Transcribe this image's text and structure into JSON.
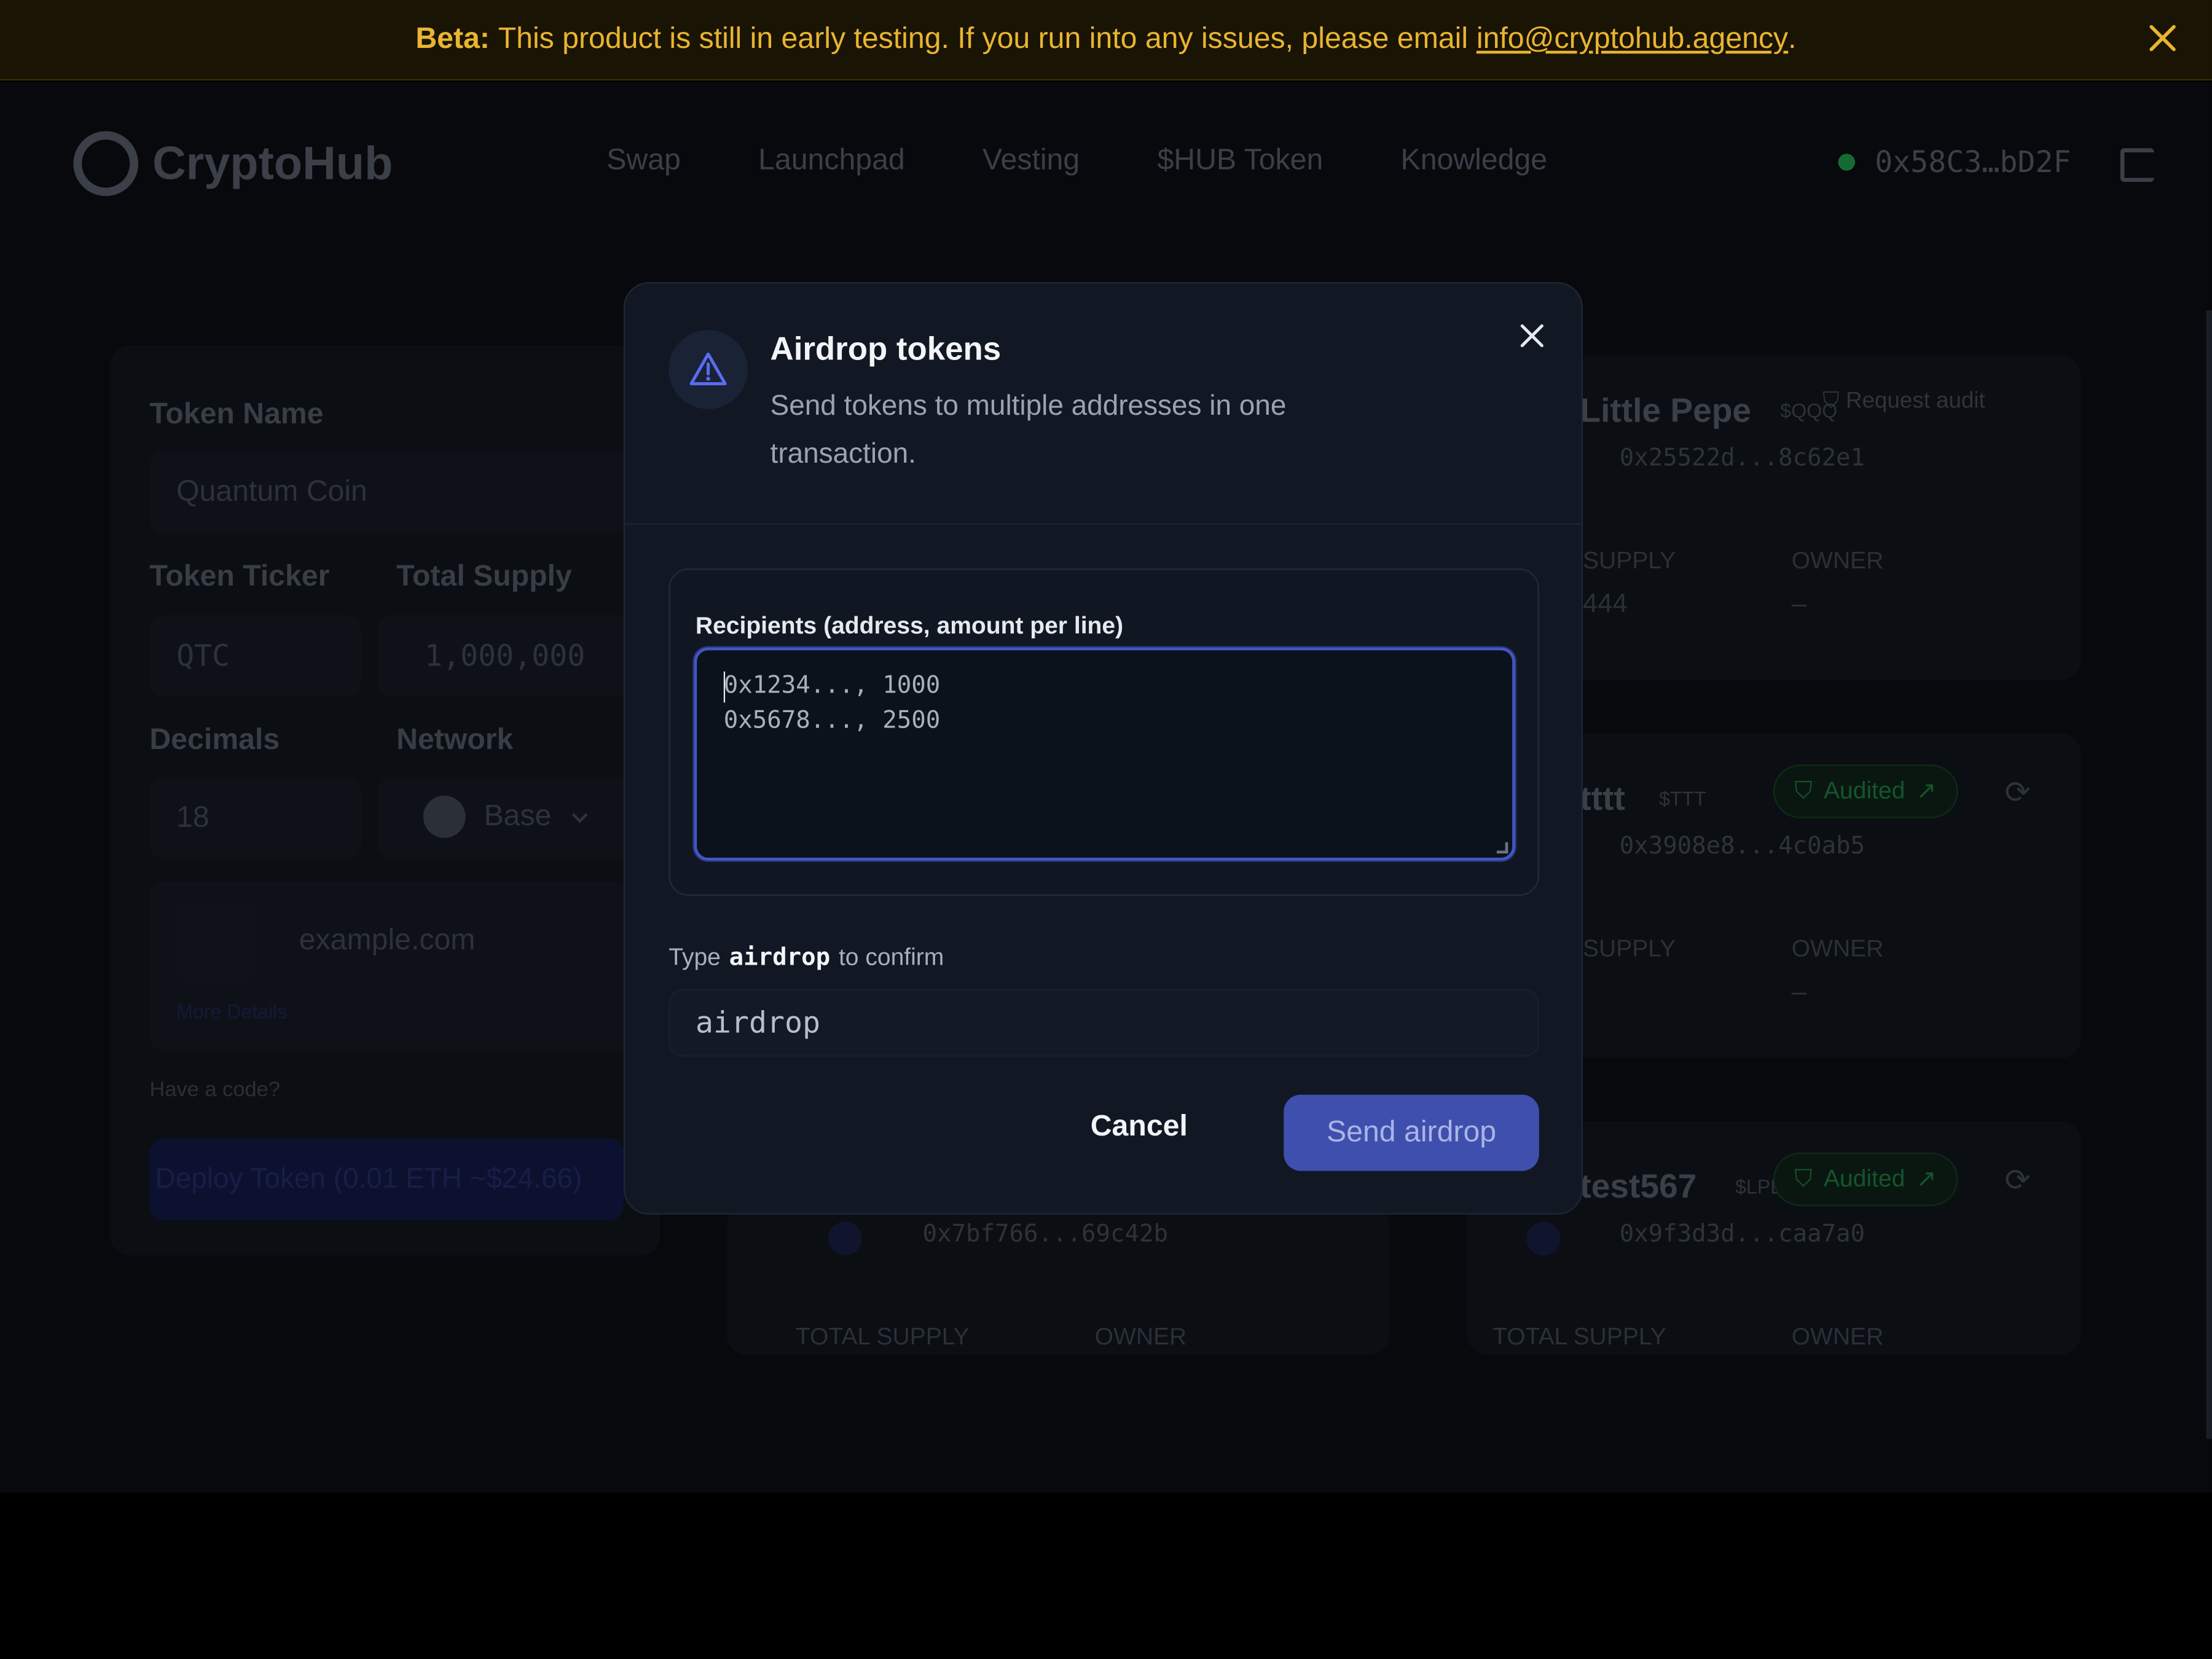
{
  "banner": {
    "label": "Beta:",
    "message": "This product is still in early testing. If you run into any issues, please email",
    "email": "info@cryptohub.agency",
    "end": "."
  },
  "header": {
    "brand": "CryptoHub",
    "nav": [
      "Swap",
      "Launchpad",
      "Vesting",
      "$HUB Token",
      "Knowledge"
    ],
    "wallet": "0x58C3…bD2F"
  },
  "form": {
    "token_name_label": "Token Name",
    "token_name_value": "Quantum Coin",
    "ticker_label": "Token Ticker",
    "ticker_value": "QTC",
    "supply_label": "Total Supply",
    "supply_value": "1,000,000",
    "decimals_label": "Decimals",
    "decimals_value": "18",
    "network_label": "Network",
    "network_value": "Base",
    "website_placeholder": "example.com",
    "more_details": "More Details",
    "have_code": "Have a code?",
    "deploy": "Deploy Token (0.01 ETH ~$24.66)"
  },
  "tokens": [
    {
      "name": "Little Pepe",
      "ticker": "$QQQ",
      "address": "0x25522d...8c62e1",
      "supply_label": "SUPPLY",
      "supply_value": "444",
      "owner_label": "OWNER",
      "owner_value": "–",
      "action": "Request audit"
    },
    {
      "name": "tttt",
      "ticker": "$TTT",
      "address": "0x3908e8...4c0ab5",
      "supply_label": "SUPPLY",
      "owner_label": "OWNER",
      "owner_value": "–",
      "badge": "Audited"
    },
    {
      "name": "test567",
      "ticker": "$LPEPE",
      "address": "0x9f3d3d...caa7a0",
      "supply_label": "TOTAL SUPPLY",
      "owner_label": "OWNER",
      "badge": "Audited"
    },
    {
      "address": "0x7bf766...69c42b",
      "supply_label": "TOTAL SUPPLY",
      "owner_label": "OWNER"
    }
  ],
  "modal": {
    "title": "Airdrop tokens",
    "subtitle": "Send tokens to multiple addresses in one transaction.",
    "recipients_label": "Recipients (address, amount per line)",
    "recipients_lines": [
      "0x1234..., 1000",
      "0x5678..., 2500"
    ],
    "confirm_prefix": "Type",
    "confirm_keyword": "airdrop",
    "confirm_suffix": "to confirm",
    "confirm_value": "airdrop",
    "cancel": "Cancel",
    "submit": "Send airdrop"
  },
  "colors": {
    "accent": "#4654c8",
    "button": "#3f4fad",
    "banner_text": "#e9b530",
    "audited_green": "#14552c"
  }
}
